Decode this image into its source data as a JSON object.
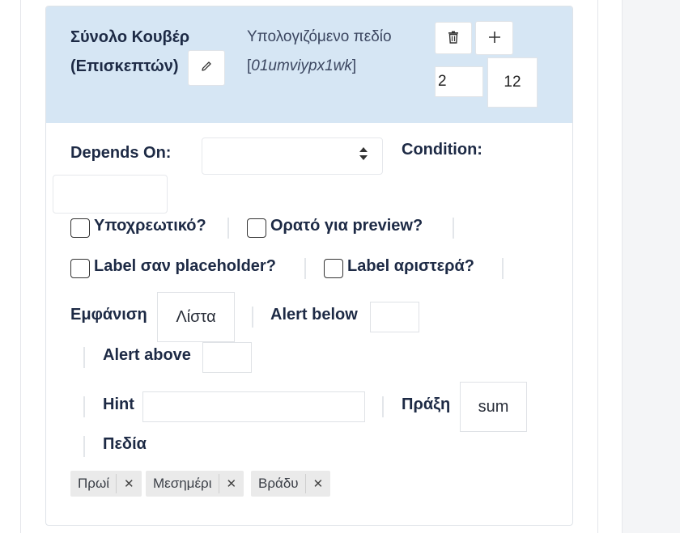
{
  "field": {
    "title": "Σύνολο Κουβέρ (Επισκεπτών)",
    "type_label": "Υπολογιζόμενο πεδίο",
    "type_id": "01umviypx1wk",
    "width_value": "2",
    "col_value": "12"
  },
  "conditions": {
    "depends_on_label": "Depends On:",
    "condition_label": "Condition:",
    "depends_on_value": "",
    "condition_value": ""
  },
  "options": {
    "required_label": "Υποχρεωτικό?",
    "preview_label": "Ορατό για preview?",
    "placeholder_label": "Label σαν placeholder?",
    "label_left_label": "Label αριστερά?"
  },
  "display": {
    "label": "Εμφάνιση",
    "value": "Λίστα",
    "alert_below_label": "Alert below",
    "alert_below_value": "",
    "alert_above_label": "Alert above",
    "alert_above_value": "",
    "hint_label": "Hint",
    "hint_value": "",
    "operation_label": "Πράξη",
    "operation_value": "sum",
    "fields_label": "Πεδία"
  },
  "tags": [
    {
      "label": "Πρωί"
    },
    {
      "label": "Μεσημέρι"
    },
    {
      "label": "Βράδυ"
    }
  ],
  "icons": {
    "edit": "pencil-icon",
    "delete": "trash-icon",
    "add": "plus-icon",
    "remove": "times-icon"
  },
  "colors": {
    "header_bg": "#d6e6f4",
    "text": "#1d2a45",
    "tag_bg": "#eaeaea"
  }
}
